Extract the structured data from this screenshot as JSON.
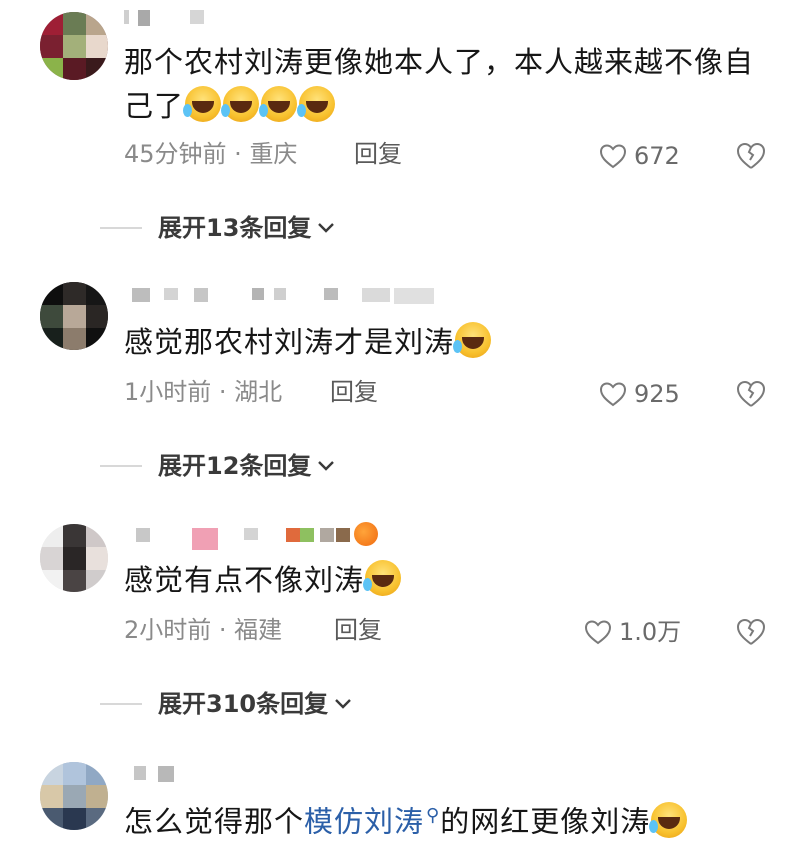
{
  "comments": [
    {
      "content_parts": [
        "那个农村刘涛更像她本人了，本人越来越不像自己了"
      ],
      "emoji_count": 4,
      "time": "45分钟前",
      "location": "重庆",
      "reply_label": "回复",
      "likes": "672",
      "expand_label": "展开13条回复"
    },
    {
      "content_parts": [
        "感觉那农村刘涛才是刘涛"
      ],
      "emoji_count": 1,
      "time": "1小时前",
      "location": "湖北",
      "reply_label": "回复",
      "likes": "925",
      "expand_label": "展开12条回复"
    },
    {
      "content_parts": [
        "感觉有点不像刘涛"
      ],
      "emoji_count": 1,
      "time": "2小时前",
      "location": "福建",
      "reply_label": "回复",
      "likes": "1.0万",
      "expand_label": "展开310条回复"
    },
    {
      "content_before": "怎么觉得那个",
      "content_link": "模仿刘涛",
      "content_after": "的网红更像刘涛",
      "emoji_count": 1
    }
  ],
  "meta_separator": " · ",
  "icons": {
    "like": "heart-outline-icon",
    "dislike": "broken-heart-icon",
    "expand": "chevron-down-icon",
    "search": "search-icon",
    "emoji": "laughing-tears-emoji"
  },
  "colors": {
    "text": "#161616",
    "meta": "#8a8a8a",
    "link": "#2b5fa8"
  }
}
